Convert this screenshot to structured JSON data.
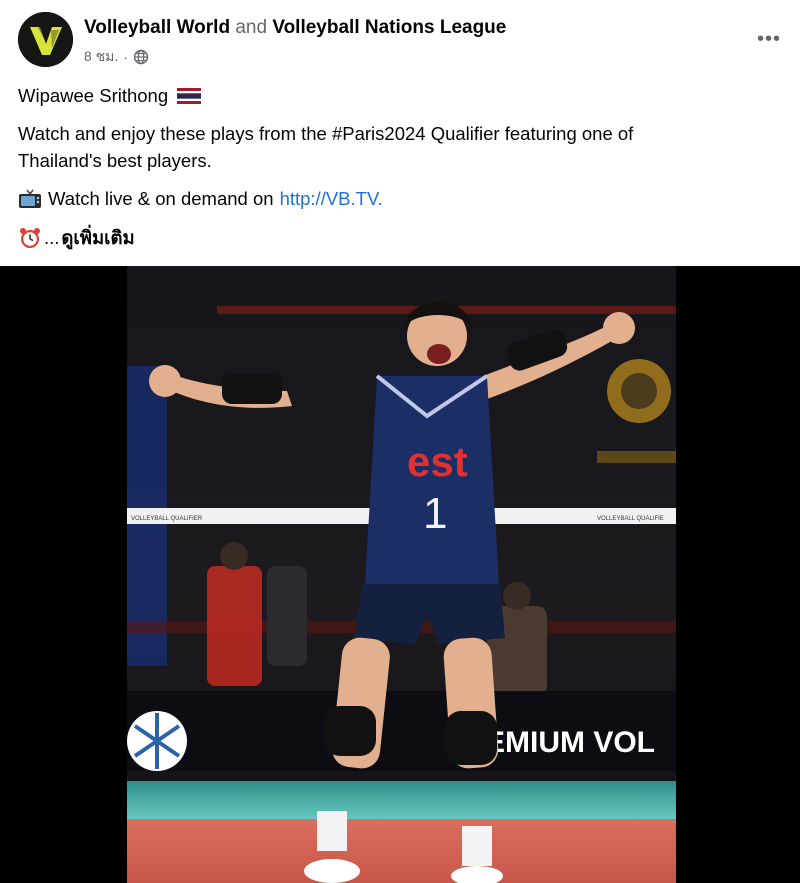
{
  "post": {
    "page_name": "Volleyball World",
    "connector": "and",
    "coauthor": "Volleyball Nations League",
    "time": "8 ชม.",
    "dot": "·",
    "audience_icon": "globe-icon",
    "more_icon": "more-options-icon",
    "more_label": "•••",
    "line1": "Wipawee Srithong",
    "flag_icon": "thailand-flag-icon",
    "line2a": "Watch and enjoy these plays from the #Paris2024 Qualifier featuring one of",
    "line2b": "Thailand's best players.",
    "tv_icon": "tv-icon",
    "line3_prefix": "Watch live & on demand on",
    "line3_link": "http://VB.TV.",
    "clock_icon": "alarm-clock-icon",
    "ellipsis": "...",
    "see_more": "ดูเพิ่มเติม"
  },
  "photo": {
    "subject": "volleyball player celebrating with arms raised",
    "jersey_text": "est",
    "jersey_number": "1",
    "net_text_left": "VOLLEYBALL QUALIFIER",
    "net_text_right": "VOLLEYBALL QUALIFIE",
    "board_text": "EMIUM VOL"
  },
  "colors": {
    "link": "#216fdb",
    "muted": "#65676b",
    "brand_yellow": "#d7e23a",
    "jersey": "#1b2f66"
  }
}
